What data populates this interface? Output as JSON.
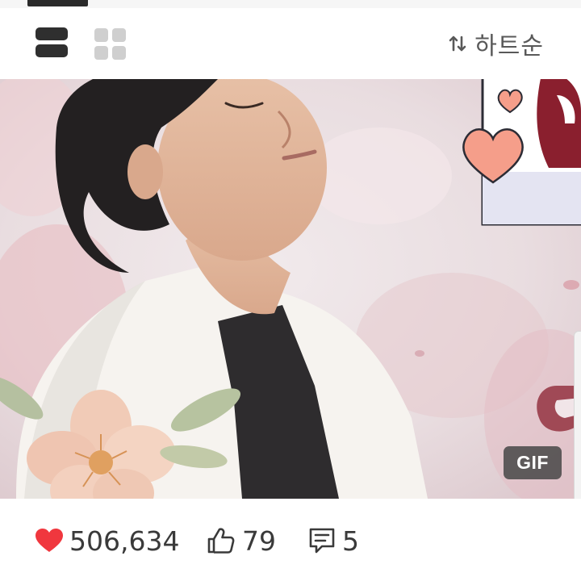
{
  "toolbar": {
    "view_modes": [
      "list-view",
      "grid-view"
    ],
    "active_view": "list-view",
    "sort_label": "하트순",
    "sort_icon": "sort-arrows-icon"
  },
  "media": {
    "badge": "GIF"
  },
  "stats": {
    "hearts": "506,634",
    "likes": "79",
    "comments": "5"
  },
  "colors": {
    "heart": "#f0373e",
    "text": "#3a3a3a",
    "sort_text": "#595959",
    "active_icon": "#2f2f2f",
    "inactive_icon": "#cfcfcf"
  }
}
